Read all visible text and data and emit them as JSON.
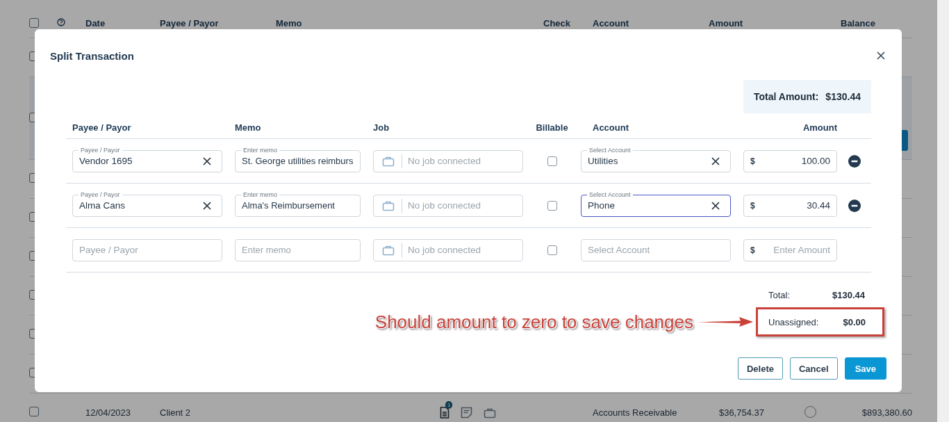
{
  "background_table": {
    "columns": [
      {
        "kind": "checkbox",
        "checked": false
      },
      {
        "kind": "help"
      },
      {
        "kind": "text",
        "label": "Date"
      },
      {
        "kind": "text",
        "label": "Payee / Payor"
      },
      {
        "kind": "text",
        "label": "Memo"
      },
      {
        "kind": "blank"
      },
      {
        "kind": "text",
        "label": "Check"
      },
      {
        "kind": "text",
        "label": "Account"
      },
      {
        "kind": "text",
        "label": "Amount"
      },
      {
        "kind": "blank"
      },
      {
        "kind": "text",
        "label": "Balance"
      }
    ],
    "rows": [
      {
        "selected": false
      },
      {
        "selected": true
      },
      {
        "selected": false
      },
      {
        "selected": false
      },
      {
        "selected": false
      },
      {
        "selected": false
      },
      {
        "selected": false
      },
      {
        "selected": false
      },
      {
        "checked": false,
        "selected": false,
        "date": "12/04/2023",
        "payee": "Client 2",
        "attachments": "1",
        "account": "Accounts Receivable",
        "amount": "$36,754.37",
        "reconciled": false,
        "balance": "$893,380.60"
      }
    ]
  },
  "dialog": {
    "title": "Split Transaction",
    "total_amount": {
      "label": "Total Amount:",
      "value": "$130.44"
    },
    "columns": [
      "Payee / Payor",
      "Memo",
      "Job",
      "Billable",
      "Account",
      "Amount"
    ],
    "lines": [
      {
        "payee": {
          "label": "Payee / Payor",
          "value": "Vendor 1695"
        },
        "memo": {
          "label": "Enter memo",
          "value": "St. George utilities reimburs"
        },
        "job": {
          "placeholder": "No job connected"
        },
        "billable": {
          "checked": false
        },
        "account": {
          "label": "Select Account",
          "value": "Utilities",
          "focused": false
        },
        "amount": {
          "currency": "$",
          "value": "100.00"
        },
        "removable": true
      },
      {
        "payee": {
          "label": "Payee / Payor",
          "value": "Alma Cans"
        },
        "memo": {
          "label": "Enter memo",
          "value": "Alma's Reimbursement"
        },
        "job": {
          "placeholder": "No job connected"
        },
        "billable": {
          "checked": false
        },
        "account": {
          "label": "Select Account",
          "value": "Phone",
          "focused": true
        },
        "amount": {
          "currency": "$",
          "value": "30.44"
        },
        "removable": true
      },
      {
        "payee": {
          "placeholder": "Payee / Payor"
        },
        "memo": {
          "placeholder": "Enter memo"
        },
        "job": {
          "placeholder": "No job connected"
        },
        "billable": {
          "checked": false
        },
        "account": {
          "placeholder": "Select Account",
          "focused": false
        },
        "amount": {
          "currency": "$",
          "placeholder": "Enter Amount"
        },
        "removable": false
      }
    ],
    "total": {
      "label": "Total:",
      "value": "$130.44"
    },
    "unassigned": {
      "label": "Unassigned:",
      "value": "$0.00"
    },
    "annotation": {
      "text": "Should amount to zero to save changes"
    },
    "buttons": [
      {
        "label": "Delete",
        "kind": "outline"
      },
      {
        "label": "Cancel",
        "kind": "outline"
      },
      {
        "label": "Save",
        "kind": "primary"
      }
    ]
  }
}
